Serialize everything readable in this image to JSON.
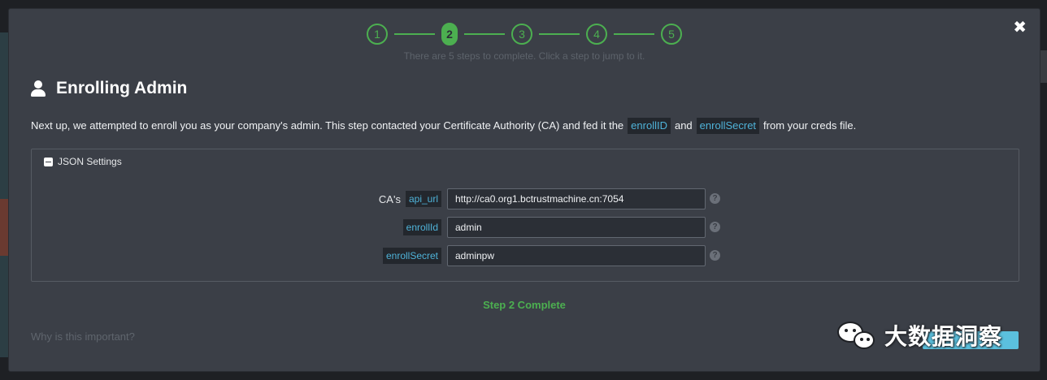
{
  "stepper": {
    "steps": [
      "1",
      "2",
      "3",
      "4",
      "5"
    ],
    "active_index": 1,
    "hint": "There are 5 steps to complete. Click a step to jump to it."
  },
  "close_label": "✖",
  "title": "Enrolling Admin",
  "intro": {
    "part1": "Next up, we attempted to enroll you as your company's admin. This step contacted your Certificate Authority (CA) and fed it the",
    "code1": "enrollID",
    "part2": "and",
    "code2": "enrollSecret",
    "part3": "from your creds file."
  },
  "panel": {
    "header": "JSON Settings",
    "fields": [
      {
        "label_prefix": "CA's",
        "label_code": "api_url",
        "value": "http://ca0.org1.bctrustmachine.cn:7054"
      },
      {
        "label_prefix": "",
        "label_code": "enrollId",
        "value": "admin"
      },
      {
        "label_prefix": "",
        "label_code": "enrollSecret",
        "value": "adminpw"
      }
    ]
  },
  "status": "Step 2 Complete",
  "why_link": "Why is this important?",
  "watermark": "大数据洞察",
  "colors": {
    "accent_green": "#4caf50",
    "code_blue": "#4fb3d9",
    "modal_bg": "#3b3f47"
  }
}
